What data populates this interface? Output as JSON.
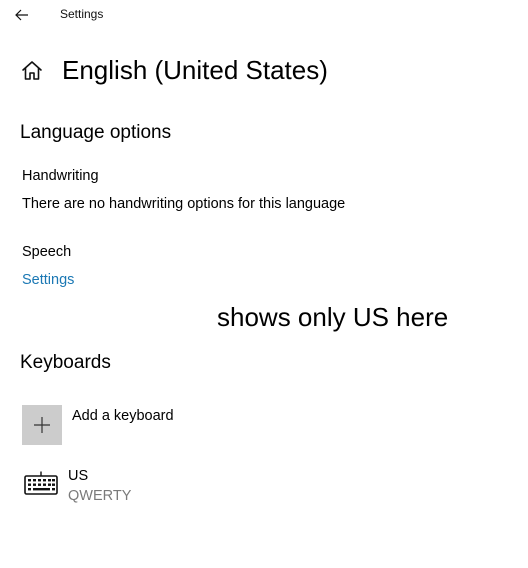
{
  "window": {
    "title": "Settings"
  },
  "header": {
    "title": "English (United States)"
  },
  "language_options": {
    "heading": "Language options",
    "handwriting_label": "Handwriting",
    "handwriting_message": "There are no handwriting options for this language",
    "speech_label": "Speech",
    "speech_link": "Settings"
  },
  "annotation": {
    "text": "shows only US here"
  },
  "keyboards": {
    "heading": "Keyboards",
    "add_label": "Add a keyboard",
    "items": [
      {
        "name": "US",
        "layout": "QWERTY"
      }
    ]
  },
  "icons": {
    "back": "back-arrow-icon",
    "home": "home-icon",
    "add": "plus-icon",
    "keyboard": "keyboard-icon"
  },
  "colors": {
    "link": "#1b78b4",
    "tile": "#cccccc",
    "secondary_text": "#7a7a7a"
  }
}
